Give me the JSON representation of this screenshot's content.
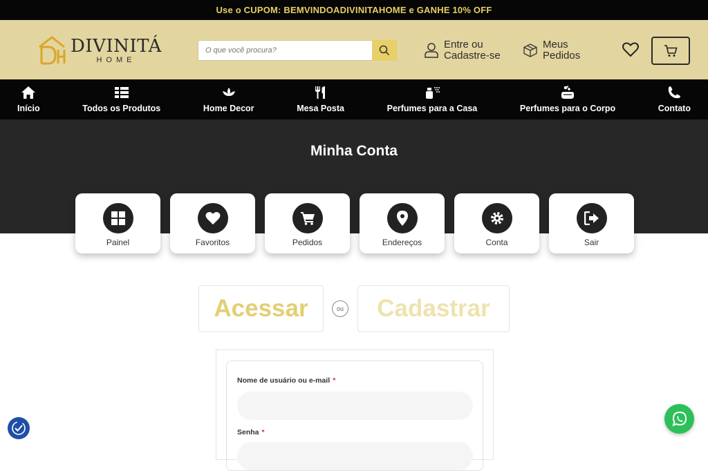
{
  "promo": {
    "text": "Use o CUPOM: BEMVINDOADIVINITAHOME e GANHE 10% OFF"
  },
  "brand": {
    "name": "DIVINITÁ",
    "sub": "HOME",
    "accent": "#e8cf68",
    "header_bg": "#e3d59f"
  },
  "search": {
    "placeholder": "O que você procura?",
    "icon": "search-icon"
  },
  "header": {
    "login_line1": "Entre ou",
    "login_line2": "Cadastre-se",
    "orders_line1": "Meus",
    "orders_line2": "Pedidos"
  },
  "nav": {
    "items": [
      {
        "label": "Início",
        "icon": "home-icon"
      },
      {
        "label": "Todos os Produtos",
        "icon": "grid-list-icon"
      },
      {
        "label": "Home Decor",
        "icon": "lotus-icon"
      },
      {
        "label": "Mesa Posta",
        "icon": "utensils-icon"
      },
      {
        "label": "Perfumes para a Casa",
        "icon": "spray-icon"
      },
      {
        "label": "Perfumes para o Corpo",
        "icon": "soap-icon"
      },
      {
        "label": "Contato",
        "icon": "phone-icon"
      }
    ]
  },
  "account": {
    "title": "Minha Conta",
    "cards": [
      {
        "label": "Painel",
        "icon": "dashboard-icon"
      },
      {
        "label": "Favoritos",
        "icon": "heart-icon"
      },
      {
        "label": "Pedidos",
        "icon": "cart-icon"
      },
      {
        "label": "Endereços",
        "icon": "map-pin-icon"
      },
      {
        "label": "Conta",
        "icon": "gear-icon"
      },
      {
        "label": "Sair",
        "icon": "sign-out-icon"
      }
    ]
  },
  "auth": {
    "login_tab": "Acessar",
    "or": "ou",
    "register_tab": "Cadastrar",
    "username_label": "Nome de usuário ou e-mail",
    "password_label": "Senha",
    "required": "*"
  }
}
